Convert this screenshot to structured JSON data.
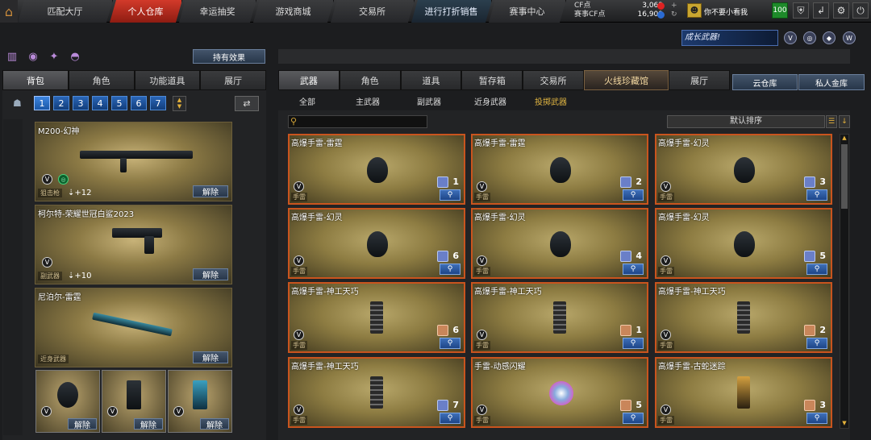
{
  "topnav": {
    "items": [
      {
        "label": "匹配大厅"
      },
      {
        "label": "个人仓库"
      },
      {
        "label": "幸运抽奖"
      },
      {
        "label": "游戏商城"
      },
      {
        "label": "交易所"
      },
      {
        "label": "进行打折销售"
      },
      {
        "label": "赛事中心"
      }
    ],
    "active": "个人仓库"
  },
  "currency": {
    "cf_label": "CF点",
    "cf_value": "3,063",
    "event_label": "赛事CF点",
    "event_value": "16,909"
  },
  "user": {
    "name": "你不要小看我",
    "level": "100"
  },
  "banner": {
    "text": "成长武器!"
  },
  "left": {
    "effect_button": "持有效果",
    "tabs": [
      "背包",
      "角色",
      "功能道具",
      "展厅"
    ],
    "pages": [
      "1",
      "2",
      "3",
      "4",
      "5",
      "6",
      "7"
    ],
    "current_page": "1",
    "release_label": "解除",
    "items": [
      {
        "name": "M200-幻神",
        "type": "狙击枪",
        "enhance": "+12"
      },
      {
        "name": "柯尔特-荣耀世冠白鲨2023",
        "type": "副武器",
        "enhance": "+10"
      },
      {
        "name": "尼泊尔-雷霆",
        "type": "近身武器"
      }
    ]
  },
  "right": {
    "tabs": [
      "武器",
      "角色",
      "道具",
      "暂存箱",
      "交易所",
      "火线珍藏馆",
      "展厅"
    ],
    "storage_tabs": [
      "云仓库",
      "私人金库"
    ],
    "subtabs": [
      "全部",
      "主武器",
      "副武器",
      "近身武器",
      "投掷武器"
    ],
    "active_subtab": "投掷武器",
    "sort_label": "默认排序",
    "type_label": "手雷",
    "cards": [
      {
        "name": "高爆手雷-雷霆",
        "count": "1"
      },
      {
        "name": "高爆手雷-雷霆",
        "count": "2"
      },
      {
        "name": "高爆手雷-幻灵",
        "count": "3"
      },
      {
        "name": "高爆手雷-幻灵",
        "count": "6"
      },
      {
        "name": "高爆手雷-幻灵",
        "count": "4"
      },
      {
        "name": "高爆手雷-幻灵",
        "count": "5"
      },
      {
        "name": "高爆手雷-神工天巧",
        "count": "6"
      },
      {
        "name": "高爆手雷-神工天巧",
        "count": "1"
      },
      {
        "name": "高爆手雷-神工天巧",
        "count": "2"
      },
      {
        "name": "高爆手雷-神工天巧",
        "count": "7"
      },
      {
        "name": "手雷-动感闪耀",
        "count": "5"
      },
      {
        "name": "高爆手雷-古蛇迷踪",
        "count": "3"
      }
    ]
  }
}
